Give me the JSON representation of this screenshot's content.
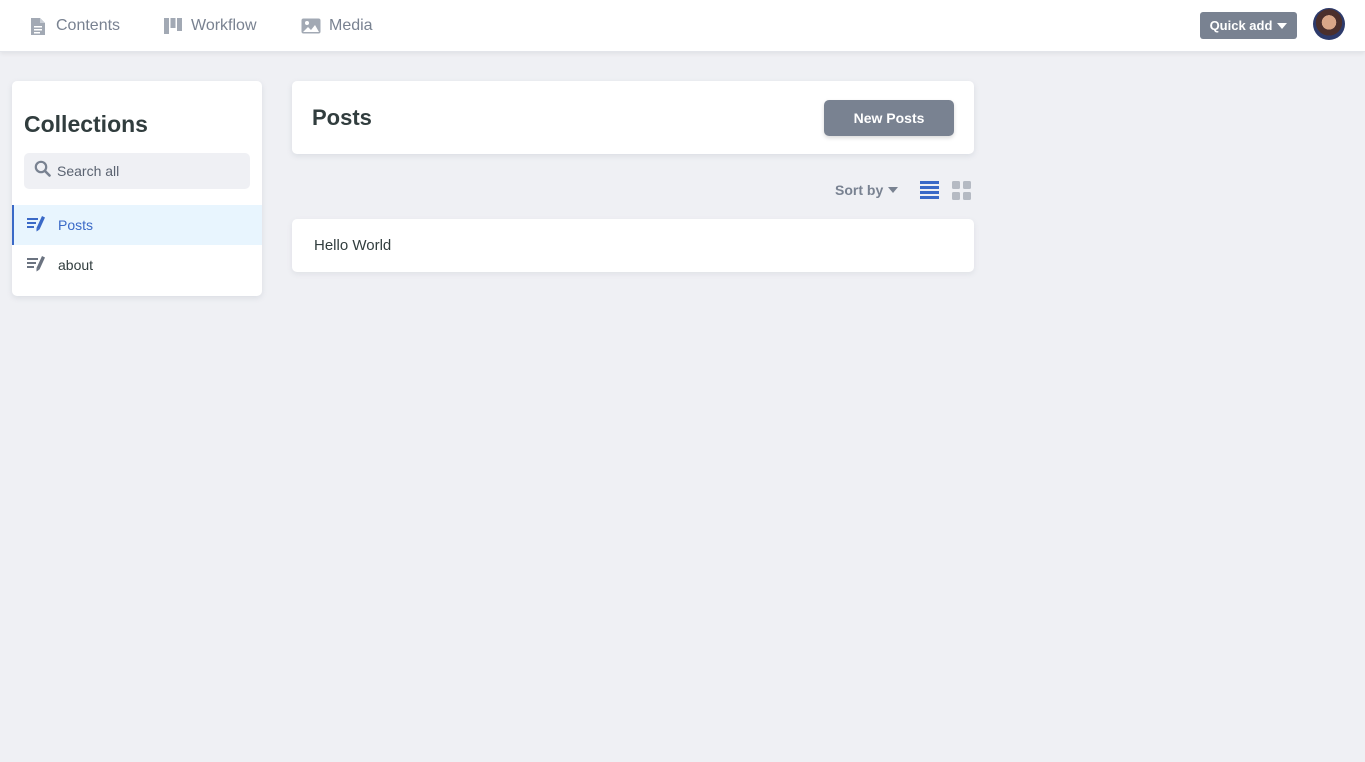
{
  "topbar": {
    "nav": [
      {
        "label": "Contents",
        "icon": "document-icon"
      },
      {
        "label": "Workflow",
        "icon": "kanban-icon"
      },
      {
        "label": "Media",
        "icon": "image-icon"
      }
    ],
    "quick_add_label": "Quick add"
  },
  "sidebar": {
    "title": "Collections",
    "search_placeholder": "Search all",
    "items": [
      {
        "label": "Posts",
        "icon": "edit-list-icon",
        "active": true
      },
      {
        "label": "about",
        "icon": "edit-list-icon",
        "active": false
      }
    ]
  },
  "main": {
    "title": "Posts",
    "new_button_label": "New Posts",
    "sort_label": "Sort by",
    "entries": [
      {
        "title": "Hello World"
      }
    ]
  },
  "colors": {
    "accent": "#3a69c7",
    "button_gray": "#798291",
    "background": "#eff0f4"
  }
}
